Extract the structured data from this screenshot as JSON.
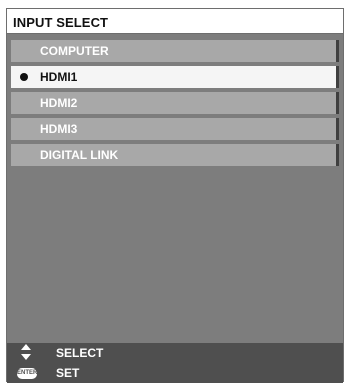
{
  "window": {
    "title": "INPUT SELECT"
  },
  "inputs": [
    {
      "label": "COMPUTER",
      "selected": false
    },
    {
      "label": "HDMI1",
      "selected": true
    },
    {
      "label": "HDMI2",
      "selected": false
    },
    {
      "label": "HDMI3",
      "selected": false
    },
    {
      "label": "DIGITAL LINK",
      "selected": false
    }
  ],
  "footer": {
    "select_label": "SELECT",
    "select_icon": "up-down-arrows-icon",
    "set_label": "SET",
    "set_icon": "enter-key-icon",
    "enter_text": "ENTER"
  },
  "colors": {
    "selected_bg": "#f5f5f5",
    "item_bg": "#a8a8a8",
    "footer_bg": "#4f4f4f"
  }
}
